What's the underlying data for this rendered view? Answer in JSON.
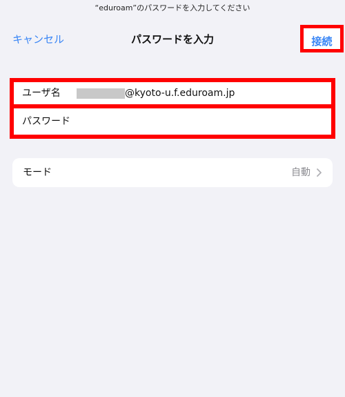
{
  "top_bar": {
    "prompt": "“eduroam”のパスワードを入力してください"
  },
  "nav": {
    "cancel_label": "キャンセル",
    "title": "パスワードを入力",
    "connect_label": "接続"
  },
  "form": {
    "username_label": "ユーザ名",
    "username_value": "@kyoto-u.f.eduroam.jp",
    "password_label": "パスワード"
  },
  "mode": {
    "label": "モード",
    "value": "自動",
    "icon": "chevron-right-icon"
  },
  "colors": {
    "accent": "#3a86f5",
    "highlight": "#ff0000",
    "background": "#f2f2f7"
  }
}
